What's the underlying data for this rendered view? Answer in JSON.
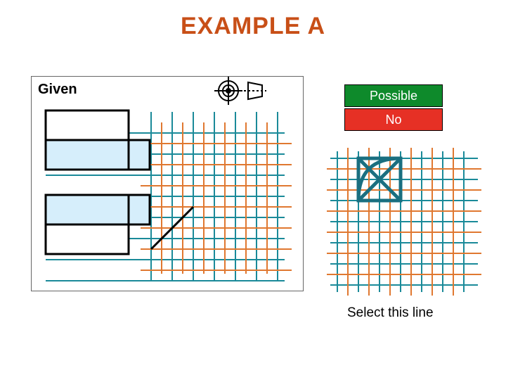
{
  "title": "EXAMPLE  A",
  "given_label": "Given",
  "possible_label": "Possible",
  "no_label": "No",
  "select_text": "Select this line",
  "colors": {
    "title": "#c84f17",
    "possible_bg": "#0e8a2b",
    "no_bg": "#e63025",
    "teal": "#1a8a99",
    "orange": "#e07830",
    "lightblue": "#d6eefb"
  }
}
